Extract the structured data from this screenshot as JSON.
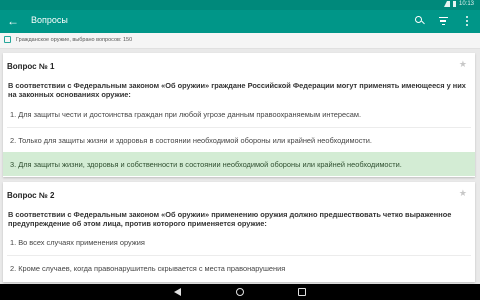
{
  "status_bar": {
    "time": "10:13"
  },
  "app_bar": {
    "title": "Вопросы",
    "icons": [
      "arrow-back-icon",
      "search-icon",
      "filter-icon",
      "more-vert-icon"
    ]
  },
  "subheader": {
    "text": "Гражданское оружие, выбрано вопросов: 150"
  },
  "colors": {
    "primary": "#009688",
    "status_bar": "#00897b",
    "correct_answer_bg": "#d3ecd4"
  },
  "questions": [
    {
      "title": "Вопрос № 1",
      "text": "В соответствии с Федеральным законом «Об оружии» граждане Российской Федерации могут применять имеющееся у них на законных основаниях оружие:",
      "answers": [
        "1. Для защиты чести и достоинства граждан при любой угрозе данным правоохраняемым интересам.",
        "2. Только для защиты жизни и здоровья в состоянии необходимой обороны или крайней необходимости.",
        "3. Для защиты жизни, здоровья и собственности в состоянии необходимой обороны или крайней необходимости."
      ]
    },
    {
      "title": "Вопрос № 2",
      "text": "В соответствии с Федеральным законом «Об оружии» применению оружия должно предшествовать четко выраженное предупреждение об этом лица, против которого применяется оружие:",
      "answers": [
        "1. Во всех случаях применения оружия",
        "2. Кроме случаев, когда правонарушитель скрывается с места правонарушения"
      ]
    }
  ]
}
